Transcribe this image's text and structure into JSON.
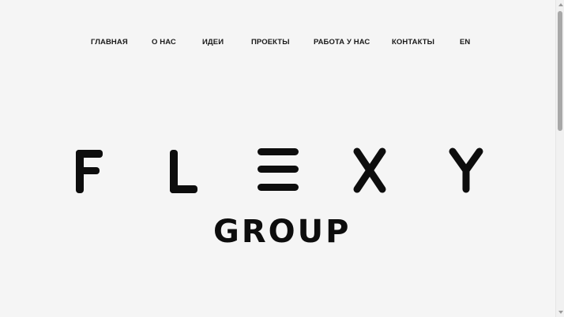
{
  "nav": {
    "items": [
      {
        "label": "ГЛАВНАЯ"
      },
      {
        "label": "О НАС"
      },
      {
        "label": "ИДЕИ"
      },
      {
        "label": "ПРОЕКТЫ"
      },
      {
        "label": "РАБОТА У НАС"
      },
      {
        "label": "КОНТАКТЫ"
      },
      {
        "label": "EN"
      }
    ]
  },
  "logo": {
    "wordmark": "FLEXY",
    "subtitle": "GROUP"
  },
  "colors": {
    "background": "#f5f5f5",
    "text": "#1a1a1a",
    "logo": "#0d0d0d"
  }
}
